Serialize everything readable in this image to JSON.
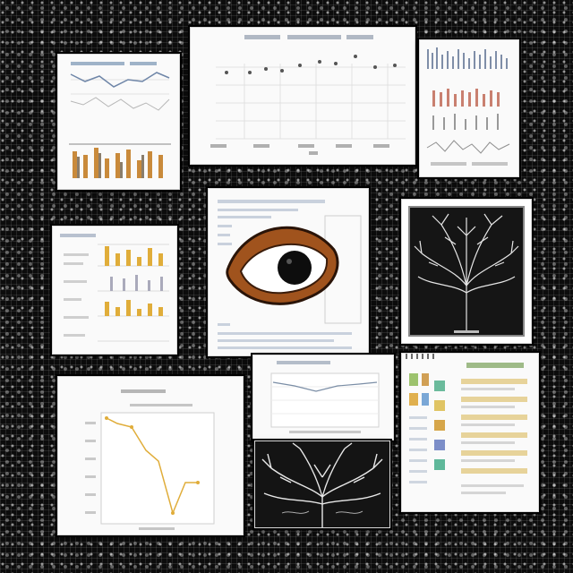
{
  "collage": {
    "background": "#0c0c0c",
    "accent_gold": "#e0ad3a",
    "accent_brown": "#a0531d",
    "eye_icon": "eye-icon",
    "tree_icon": "tree-icon"
  }
}
